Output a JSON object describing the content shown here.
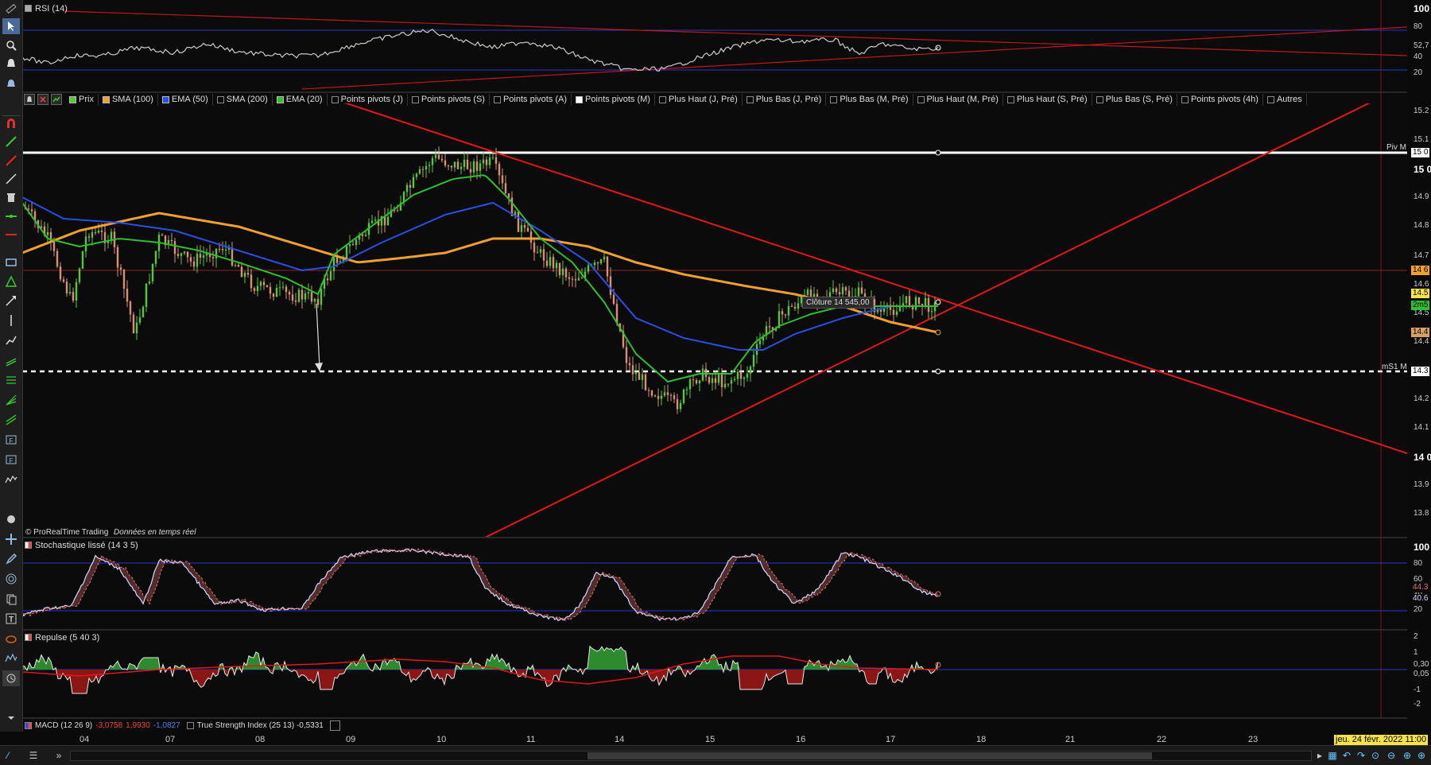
{
  "colors": {
    "sma100": "#f0a030",
    "ema50": "#2b4fe0",
    "ema20": "#2fbf2f",
    "trend": "#e01818",
    "pivot": "#ffffff",
    "up": "#58c83a",
    "down": "#d8907a",
    "rsi": "#cccccc",
    "level": "#2a35c8"
  },
  "rsi_panel": {
    "title": "RSI (14)",
    "ticks": [
      "100",
      "80",
      "52,7",
      "40",
      "20"
    ]
  },
  "price_panel": {
    "chips": [
      {
        "label": "Prix",
        "on": true,
        "color": "#58c83a"
      },
      {
        "label": "SMA (100)",
        "on": true,
        "color": "#f0a030"
      },
      {
        "label": "EMA (50)",
        "on": true,
        "color": "#2b4fe0"
      },
      {
        "label": "SMA (200)",
        "on": false,
        "color": ""
      },
      {
        "label": "EMA (20)",
        "on": true,
        "color": "#2fbf2f"
      },
      {
        "label": "Points pivots (J)",
        "on": false,
        "color": ""
      },
      {
        "label": "Points pivots (S)",
        "on": false,
        "color": ""
      },
      {
        "label": "Points pivots (A)",
        "on": false,
        "color": ""
      },
      {
        "label": "Points pivots (M)",
        "on": true,
        "color": "#ffffff"
      },
      {
        "label": "Plus Haut (J, Pré)",
        "on": false,
        "color": ""
      },
      {
        "label": "Plus Bas (J, Pré)",
        "on": false,
        "color": ""
      },
      {
        "label": "Plus Bas (M, Pré)",
        "on": false,
        "color": ""
      },
      {
        "label": "Plus Haut (M, Pré)",
        "on": false,
        "color": ""
      },
      {
        "label": "Plus Haut (S, Pré)",
        "on": false,
        "color": ""
      },
      {
        "label": "Plus Bas (S, Pré)",
        "on": false,
        "color": ""
      },
      {
        "label": "Points pivots (4h)",
        "on": false,
        "color": ""
      },
      {
        "label": "Autres",
        "on": false,
        "color": ""
      }
    ],
    "ticks": [
      "15.2",
      "15.1",
      "15 0",
      "14.9",
      "14.8",
      "14.7",
      "14.6",
      "14.5",
      "14.4",
      "14.3",
      "14.2",
      "14.1",
      "14 0",
      "13.9",
      "13.8"
    ],
    "piv_label": "Piv M",
    "ms1_label": "mS1 M",
    "tags": {
      "piv": "15 0",
      "orange": "14 6",
      "yellow": "14.5",
      "green": "2m5",
      "gray": "14.4",
      "ms1": "14.3"
    },
    "tooltip": "Clôture   14 545,00",
    "credit": "© ProRealTime Trading",
    "credit_sub": "Données en temps réel"
  },
  "stoch_panel": {
    "title": "Stochastique lissé (14 3 5)",
    "ticks": [
      "100",
      "80",
      "60",
      "40",
      "20"
    ],
    "tags": [
      "44.3",
      "40.6"
    ]
  },
  "repulse_panel": {
    "title": "Repulse (5 40 3)",
    "ticks": [
      "2",
      "1",
      "0,30",
      "0,05",
      "-1",
      "-2"
    ]
  },
  "footer": {
    "macd_label": "MACD (12 26 9)",
    "macd_v1": "-3,0758",
    "macd_v2": "1,9930",
    "macd_v3": "-1,0827",
    "tsi_label": "True Strength Index (25 13) -0,5331",
    "x_ticks": [
      "04",
      "07",
      "08",
      "09",
      "10",
      "11",
      "14",
      "15",
      "16",
      "17",
      "18",
      "21",
      "22",
      "23"
    ],
    "date": "jeu. 24 févr. 2022 11:00"
  }
}
